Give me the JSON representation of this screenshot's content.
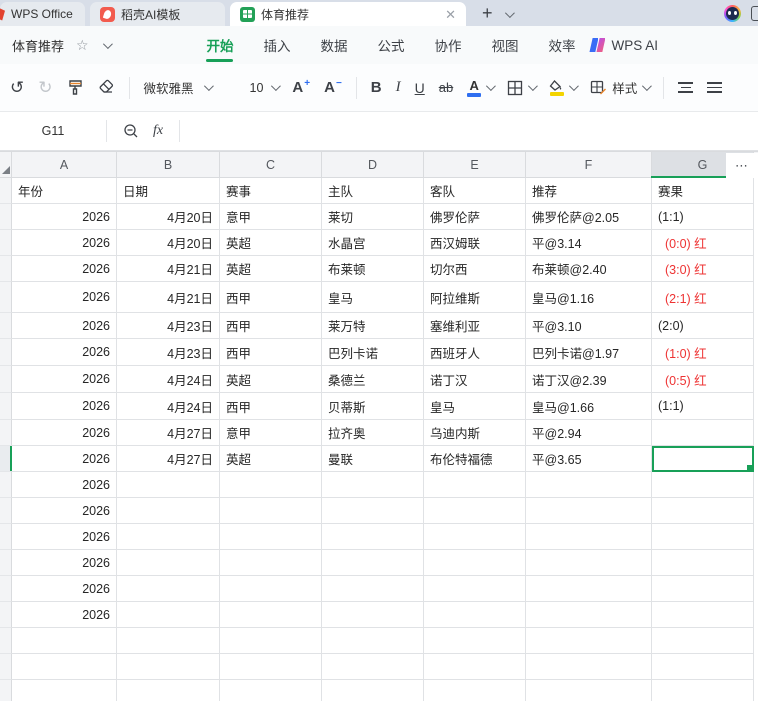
{
  "window": {
    "tabs": [
      {
        "label": "WPS Office"
      },
      {
        "label": "稻壳AI模板"
      },
      {
        "label": "体育推荐"
      }
    ],
    "close_tab_glyph": "✕",
    "new_tab_glyph": "+"
  },
  "titlebar": {
    "doc_title": "体育推荐",
    "star_glyph": "☆",
    "menus": [
      "开始",
      "插入",
      "数据",
      "公式",
      "协作",
      "视图",
      "效率"
    ],
    "active_menu": "开始",
    "wps_ai_label": "WPS AI"
  },
  "toolbar": {
    "undo_glyph": "↺",
    "redo_glyph": "↻",
    "font_name": "微软雅黑",
    "font_size": "10",
    "grow_font": "A",
    "shrink_font": "A",
    "bold": "B",
    "italic": "I",
    "underline": "U",
    "strikethrough": "ab",
    "font_color_letter": "A",
    "style_label": "样式",
    "font_color_hex": "#2f6ef0",
    "fill_color_hex": "#f3d400"
  },
  "formula_bar": {
    "cell_ref": "G11",
    "fx_glyph": "fx",
    "formula_value": ""
  },
  "sheet": {
    "columns": [
      "A",
      "B",
      "C",
      "D",
      "E",
      "F",
      "G"
    ],
    "selected_column": "G",
    "more_columns_glyph": "⋯",
    "selection": {
      "row_index": 10,
      "col_index": 6,
      "cell_ref": "G11"
    },
    "colors": {
      "accent_green": "#18a058",
      "result_red": "#ee3333"
    },
    "rows": [
      {
        "header": true,
        "cells": [
          "年份",
          "日期",
          "赛事",
          "主队",
          "客队",
          "推荐",
          "赛果"
        ]
      },
      {
        "cells": [
          "2026",
          "4月20日",
          "意甲",
          "莱切",
          "佛罗伦萨",
          "佛罗伦萨@2.05",
          "(1:1)"
        ],
        "red": false
      },
      {
        "cells": [
          "2026",
          "4月20日",
          "英超",
          "水晶宫",
          "西汉姆联",
          "平@3.14",
          "(0:0) 红"
        ],
        "red": true
      },
      {
        "cells": [
          "2026",
          "4月21日",
          "英超",
          "布莱顿",
          "切尔西",
          "布莱顿@2.40",
          "(3:0) 红"
        ],
        "red": true
      },
      {
        "cells": [
          "2026",
          "4月21日",
          "西甲",
          "皇马",
          "阿拉维斯",
          "皇马@1.16",
          "(2:1) 红"
        ],
        "red": true
      },
      {
        "cells": [
          "2026",
          "4月23日",
          "西甲",
          "莱万特",
          "塞维利亚",
          "平@3.10",
          "(2:0)"
        ],
        "red": false
      },
      {
        "cells": [
          "2026",
          "4月23日",
          "西甲",
          "巴列卡诺",
          "西班牙人",
          "巴列卡诺@1.97",
          "(1:0) 红"
        ],
        "red": true
      },
      {
        "cells": [
          "2026",
          "4月24日",
          "英超",
          "桑德兰",
          "诺丁汉",
          "诺丁汉@2.39",
          "(0:5) 红"
        ],
        "red": true
      },
      {
        "cells": [
          "2026",
          "4月24日",
          "西甲",
          "贝蒂斯",
          "皇马",
          "皇马@1.66",
          "(1:1)"
        ],
        "red": false
      },
      {
        "cells": [
          "2026",
          "4月27日",
          "意甲",
          "拉齐奥",
          "乌迪内斯",
          "平@2.94",
          ""
        ],
        "red": false
      },
      {
        "cells": [
          "2026",
          "4月27日",
          "英超",
          "曼联",
          "布伦特福德",
          "平@3.65",
          ""
        ],
        "red": false
      },
      {
        "cells": [
          "2026",
          "",
          "",
          "",
          "",
          "",
          ""
        ],
        "red": false
      },
      {
        "cells": [
          "2026",
          "",
          "",
          "",
          "",
          "",
          ""
        ],
        "red": false
      },
      {
        "cells": [
          "2026",
          "",
          "",
          "",
          "",
          "",
          ""
        ],
        "red": false
      },
      {
        "cells": [
          "2026",
          "",
          "",
          "",
          "",
          "",
          ""
        ],
        "red": false
      },
      {
        "cells": [
          "2026",
          "",
          "",
          "",
          "",
          "",
          ""
        ],
        "red": false
      },
      {
        "cells": [
          "2026",
          "",
          "",
          "",
          "",
          "",
          ""
        ],
        "red": false
      },
      {
        "cells": [
          "",
          "",
          "",
          "",
          "",
          "",
          ""
        ],
        "red": false
      },
      {
        "cells": [
          "",
          "",
          "",
          "",
          "",
          "",
          ""
        ],
        "red": false
      },
      {
        "cells": [
          "",
          "",
          "",
          "",
          "",
          "",
          ""
        ],
        "red": false
      }
    ]
  }
}
